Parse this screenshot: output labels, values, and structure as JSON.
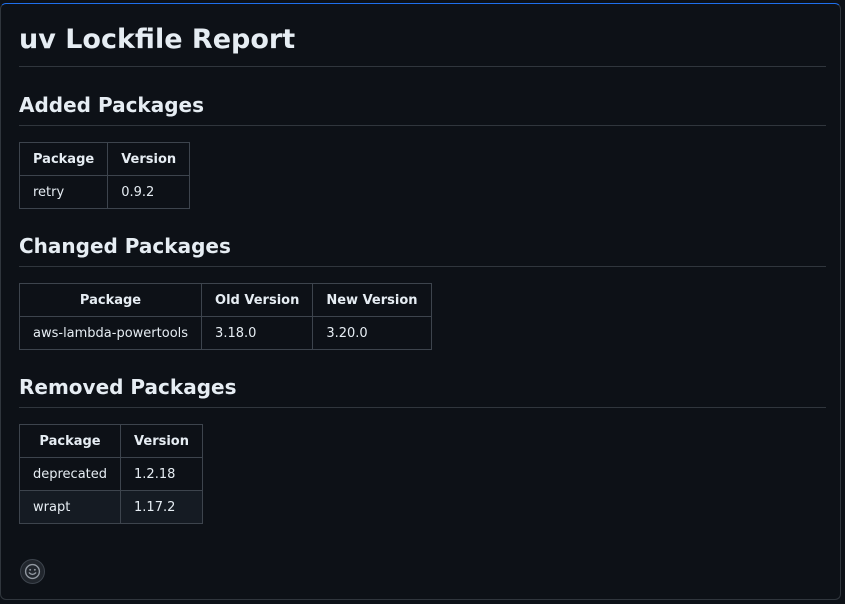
{
  "report": {
    "title": "uv Lockfile Report"
  },
  "added": {
    "heading": "Added Packages",
    "headers": [
      "Package",
      "Version"
    ],
    "rows": [
      [
        "retry",
        "0.9.2"
      ]
    ]
  },
  "changed": {
    "heading": "Changed Packages",
    "headers": [
      "Package",
      "Old Version",
      "New Version"
    ],
    "rows": [
      [
        "aws-lambda-powertools",
        "3.18.0",
        "3.20.0"
      ]
    ]
  },
  "removed": {
    "heading": "Removed Packages",
    "headers": [
      "Package",
      "Version"
    ],
    "rows": [
      [
        "deprecated",
        "1.2.18"
      ],
      [
        "wrapt",
        "1.17.2"
      ]
    ]
  },
  "reactions": {
    "icon": "smiley-icon"
  }
}
